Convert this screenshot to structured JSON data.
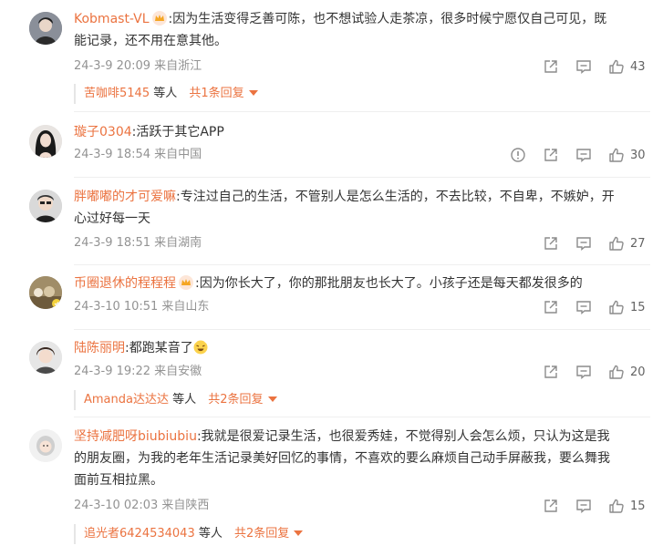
{
  "comments": [
    {
      "user": "Kobmast-VL",
      "crown": true,
      "text_line1": ":因为生活变得乏善可陈，也不想试验人走茶凉，很多时候宁愿仅自己可见，既",
      "text_line2": "能记录，还不用在意其他。",
      "date": "24-3-9 20:09",
      "source": "来自浙江",
      "likes": "43",
      "reply": {
        "name": "苦咖啡5145",
        "others": " 等人 ",
        "count": "共1条回复"
      }
    },
    {
      "user": "璇子0304",
      "crown": false,
      "text_line1": ":活跃于其它APP",
      "date": "24-3-9 18:54",
      "source": "来自中国",
      "likes": "30"
    },
    {
      "user": "胖嘟嘟的才可爱嘛",
      "crown": false,
      "text_line1": ":专注过自己的生活，不管别人是怎么生活的，不去比较，不自卑，不嫉妒，开",
      "text_line2": "心过好每一天",
      "date": "24-3-9 18:51",
      "source": "来自湖南",
      "likes": "27"
    },
    {
      "user": "币圈退休的程程程",
      "crown": true,
      "text_line1": ":因为你长大了，你的那批朋友也长大了。小孩子还是每天都发很多的",
      "date": "24-3-10 10:51",
      "source": "来自山东",
      "likes": "15"
    },
    {
      "user": "陆陈丽明",
      "crown": false,
      "text_line1": ":都跑某音了",
      "date": "24-3-9 19:22",
      "source": "来自安徽",
      "likes": "20",
      "reply": {
        "name": "Amanda达达达",
        "others": " 等人 ",
        "count": "共2条回复"
      }
    },
    {
      "user": "坚持减肥呀biubiubiu",
      "crown": false,
      "text_line1": ":我就是很爱记录生活，也很爱秀娃，不觉得别人会怎么烦，只认为这是我",
      "text_line2": "的朋友圈，为我的老年生活记录美好回忆的事情，不喜欢的要么麻烦自己动手屏蔽我，要么舞我",
      "text_line3": "面前互相拉黑。",
      "date": "24-3-10 02:03",
      "source": "来自陕西",
      "likes": "15",
      "reply": {
        "name": "追光者6424534043",
        "others": " 等人 ",
        "count": "共2条回复"
      }
    }
  ],
  "icons": {
    "share": "share-icon",
    "comment": "comment-icon",
    "like": "like-icon",
    "report": "report-icon",
    "crown": "crown-badge-icon"
  },
  "colors": {
    "username": "#eb7340",
    "meta": "#939393",
    "text": "#333333"
  }
}
